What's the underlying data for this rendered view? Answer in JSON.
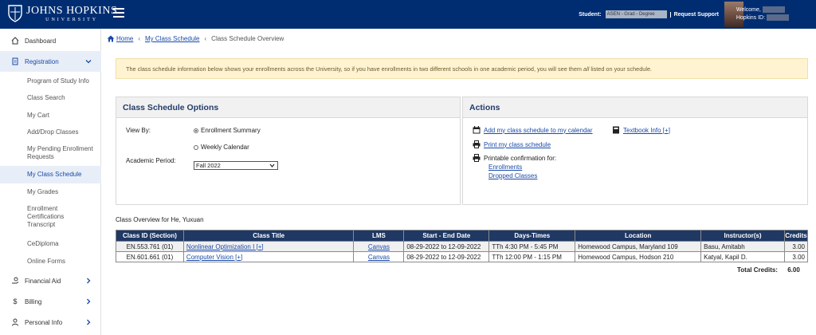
{
  "header": {
    "logo_line1": "JOHNS HOPKINS",
    "logo_line2": "UNIVERSITY",
    "student_label": "Student:",
    "student_value": "ASEN - Grad - Degree",
    "request_support": "Request Support",
    "welcome": "Welcome,",
    "hopkins_id": "Hopkins ID:",
    "brand_color": "#002d72"
  },
  "sidebar": {
    "dashboard": "Dashboard",
    "registration": "Registration",
    "sub_items": [
      "Program of Study Info",
      "Class Search",
      "My Cart",
      "Add/Drop Classes",
      "My Pending Enrollment Requests",
      "My Class Schedule",
      "My Grades",
      "Enrollment Certifications Transcript",
      "CeDiploma",
      "Online Forms"
    ],
    "financial_aid": "Financial Aid",
    "billing": "Billing",
    "personal_info": "Personal Info"
  },
  "breadcrumb": {
    "home": "Home",
    "my_class_schedule": "My Class Schedule",
    "current": "Class Schedule Overview"
  },
  "notice": {
    "before": "The class schedule information below shows your enrollments across the University, so if you have enrollments in two different schools in one academic period, you will see them ",
    "emphasis": "all",
    "after": " listed on your schedule."
  },
  "options": {
    "title": "Class Schedule Options",
    "view_by_label": "View By:",
    "view_enrollment": "Enrollment Summary",
    "view_weekly": "Weekly Calendar",
    "selected_view": "Enrollment Summary",
    "academic_period_label": "Academic Period:",
    "academic_period_value": "Fall 2022"
  },
  "actions": {
    "title": "Actions",
    "add_calendar": "Add my class schedule to my calendar",
    "textbook": "Textbook Info [+]",
    "print": "Print my class schedule",
    "printable": "Printable confirmation for:",
    "enrollments": "Enrollments",
    "dropped": "Dropped Classes"
  },
  "overview": {
    "title": "Class Overview for He, Yuxuan",
    "columns": [
      "Class ID (Section)",
      "Class Title",
      "LMS",
      "Start - End Date",
      "Days-Times",
      "Location",
      "Instructor(s)",
      "Credits"
    ],
    "rows": [
      [
        "EN.553.761 (01)",
        "Nonlinear Optimization I [+]",
        "Canvas",
        "08-29-2022 to 12-09-2022",
        "TTh 4:30 PM - 5:45 PM",
        "Homewood Campus, Maryland 109",
        "Basu, Amitabh",
        "3.00"
      ],
      [
        "EN.601.661 (01)",
        "Computer Vision [+]",
        "Canvas",
        "08-29-2022 to 12-09-2022",
        "TTh 12:00 PM - 1:15 PM",
        "Homewood Campus, Hodson 210",
        "Katyal, Kapil D.",
        "3.00"
      ]
    ],
    "total_label": "Total Credits:",
    "total_value": "6.00"
  }
}
